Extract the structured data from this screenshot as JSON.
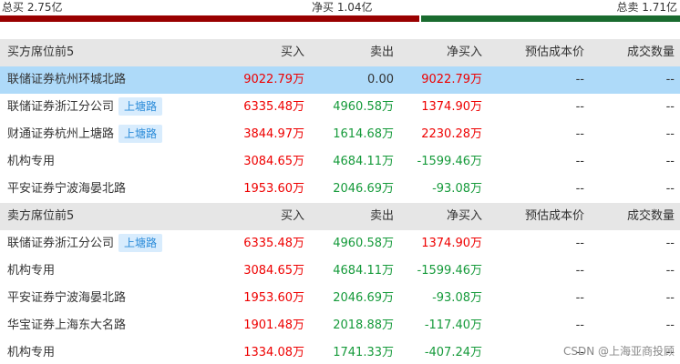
{
  "colors": {
    "up": "#ee0000",
    "down": "#159a3a",
    "neutral": "#333333",
    "bar_buy": "#990000",
    "bar_sell": "#1a6b2f",
    "tag_bg": "#d8ecfd",
    "tag_text": "#2a8bd9"
  },
  "summary": {
    "buy_total": "总买 2.75亿",
    "net_buy": "净买 1.04亿",
    "sell_total": "总卖 1.71亿"
  },
  "columns": {
    "buy": "买入",
    "sell": "卖出",
    "net": "净买入",
    "cost": "预估成本价",
    "volume": "成交数量"
  },
  "buy_section": {
    "title": "买方席位前5",
    "rows": [
      {
        "name": "联储证券杭州环城北路",
        "tag": "",
        "buy": "9022.79万",
        "sell": "0.00",
        "net": "9022.79万",
        "cost": "--",
        "volume": "--",
        "buy_color": "up",
        "sell_color": "neutral",
        "net_color": "up",
        "highlight": true
      },
      {
        "name": "联储证券浙江分公司",
        "tag": "上塘路",
        "buy": "6335.48万",
        "sell": "4960.58万",
        "net": "1374.90万",
        "cost": "--",
        "volume": "--",
        "buy_color": "up",
        "sell_color": "down",
        "net_color": "up",
        "highlight": false
      },
      {
        "name": "财通证券杭州上塘路",
        "tag": "上塘路",
        "buy": "3844.97万",
        "sell": "1614.68万",
        "net": "2230.28万",
        "cost": "--",
        "volume": "--",
        "buy_color": "up",
        "sell_color": "down",
        "net_color": "up",
        "highlight": false
      },
      {
        "name": "机构专用",
        "tag": "",
        "buy": "3084.65万",
        "sell": "4684.11万",
        "net": "-1599.46万",
        "cost": "--",
        "volume": "--",
        "buy_color": "up",
        "sell_color": "down",
        "net_color": "down",
        "highlight": false
      },
      {
        "name": "平安证券宁波海晏北路",
        "tag": "",
        "buy": "1953.60万",
        "sell": "2046.69万",
        "net": "-93.08万",
        "cost": "--",
        "volume": "--",
        "buy_color": "up",
        "sell_color": "down",
        "net_color": "down",
        "highlight": false
      }
    ]
  },
  "sell_section": {
    "title": "卖方席位前5",
    "rows": [
      {
        "name": "联储证券浙江分公司",
        "tag": "上塘路",
        "buy": "6335.48万",
        "sell": "4960.58万",
        "net": "1374.90万",
        "cost": "--",
        "volume": "--",
        "buy_color": "up",
        "sell_color": "down",
        "net_color": "up",
        "highlight": false
      },
      {
        "name": "机构专用",
        "tag": "",
        "buy": "3084.65万",
        "sell": "4684.11万",
        "net": "-1599.46万",
        "cost": "--",
        "volume": "--",
        "buy_color": "up",
        "sell_color": "down",
        "net_color": "down",
        "highlight": false
      },
      {
        "name": "平安证券宁波海晏北路",
        "tag": "",
        "buy": "1953.60万",
        "sell": "2046.69万",
        "net": "-93.08万",
        "cost": "--",
        "volume": "--",
        "buy_color": "up",
        "sell_color": "down",
        "net_color": "down",
        "highlight": false
      },
      {
        "name": "华宝证券上海东大名路",
        "tag": "",
        "buy": "1901.48万",
        "sell": "2018.88万",
        "net": "-117.40万",
        "cost": "--",
        "volume": "--",
        "buy_color": "up",
        "sell_color": "down",
        "net_color": "down",
        "highlight": false
      },
      {
        "name": "机构专用",
        "tag": "",
        "buy": "1334.08万",
        "sell": "1741.33万",
        "net": "-407.24万",
        "cost": "--",
        "volume": "--",
        "buy_color": "up",
        "sell_color": "down",
        "net_color": "down",
        "highlight": false
      }
    ]
  },
  "watermark": "CSDN @上海亚商投顾"
}
